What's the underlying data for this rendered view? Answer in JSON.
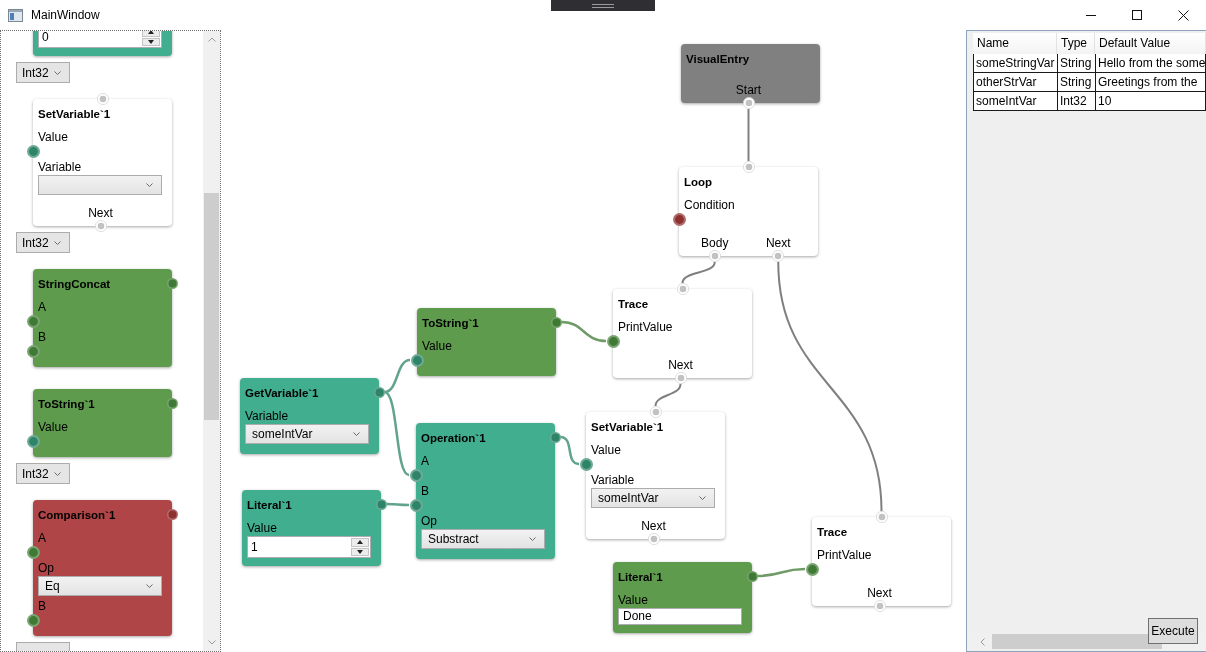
{
  "window": {
    "title": "MainWindow"
  },
  "palette": {
    "items": [
      {
        "kind": "node_fragment",
        "color": "#41af8f",
        "fields": [
          {
            "kind": "number",
            "value": "0"
          }
        ]
      },
      {
        "kind": "type_selector",
        "value": "Int32"
      },
      {
        "kind": "node",
        "title": "SetVariable`1",
        "color": "#ffffff",
        "flow_in": true,
        "fields": [
          {
            "kind": "port",
            "label": "Value",
            "color": "#2e8468"
          },
          {
            "kind": "dropdown",
            "label": "Variable"
          }
        ],
        "flow_out": [
          {
            "label": "Next"
          }
        ]
      },
      {
        "kind": "type_selector",
        "value": "Int32"
      },
      {
        "kind": "node",
        "title": "StringConcat",
        "color": "#5e9b4d",
        "flow_in": false,
        "output": {
          "color": "#3f7a34"
        },
        "fields": [
          {
            "kind": "port",
            "label": "A",
            "color": "#3f7a34"
          },
          {
            "kind": "port",
            "label": "B",
            "color": "#3f7a34"
          }
        ]
      },
      {
        "kind": "node",
        "title": "ToString`1",
        "color": "#5e9b4d",
        "flow_in": false,
        "output": {
          "color": "#3f7a34"
        },
        "fields": [
          {
            "kind": "port",
            "label": "Value",
            "color": "#2e8468"
          }
        ]
      },
      {
        "kind": "type_selector",
        "value": "Int32"
      },
      {
        "kind": "node",
        "title": "Comparison`1",
        "color": "#af4546",
        "flow_in": false,
        "output": {
          "color": "#8e2f30"
        },
        "fields": [
          {
            "kind": "port",
            "label": "A",
            "color": "#3f7a34"
          },
          {
            "kind": "dropdown",
            "label": "Op",
            "value": "Eq"
          },
          {
            "kind": "port",
            "label": "B",
            "color": "#3f7a34"
          }
        ]
      },
      {
        "kind": "type_selector"
      }
    ]
  },
  "canvas": {
    "nodes": [
      {
        "title": "VisualEntry",
        "color": "#808080",
        "flow_in": false,
        "flow_out": [
          {
            "label": "Start"
          }
        ]
      },
      {
        "title": "Loop",
        "color": "#ffffff",
        "flow_in": true,
        "fields": [
          {
            "kind": "port",
            "label": "Condition",
            "color": "#8e2f30"
          }
        ],
        "flow_out": [
          {
            "label": "Body"
          },
          {
            "label": "Next"
          }
        ]
      },
      {
        "title": "ToString`1",
        "color": "#5e9b4d",
        "flow_in": false,
        "output": {
          "color": "#3f7a34"
        },
        "fields": [
          {
            "kind": "port",
            "label": "Value",
            "color": "#2e8468"
          }
        ]
      },
      {
        "title": "Trace",
        "color": "#ffffff",
        "flow_in": true,
        "fields": [
          {
            "kind": "port",
            "label": "PrintValue",
            "color": "#3f7a34"
          }
        ],
        "flow_out": [
          {
            "label": "Next"
          }
        ]
      },
      {
        "title": "GetVariable`1",
        "color": "#41af8f",
        "flow_in": false,
        "output": {
          "color": "#2e8468"
        },
        "fields": [
          {
            "kind": "dropdown",
            "label": "Variable",
            "value": "someIntVar"
          }
        ]
      },
      {
        "title": "Literal`1",
        "color": "#41af8f",
        "flow_in": false,
        "output": {
          "color": "#2e8468"
        },
        "fields": [
          {
            "kind": "number",
            "label": "Value",
            "value": "1"
          }
        ]
      },
      {
        "title": "Operation`1",
        "color": "#41af8f",
        "flow_in": false,
        "output": {
          "color": "#2e8468"
        },
        "fields": [
          {
            "kind": "port",
            "label": "A",
            "color": "#2e8468"
          },
          {
            "kind": "port",
            "label": "B",
            "color": "#2e8468"
          },
          {
            "kind": "dropdown",
            "label": "Op",
            "value": "Substract"
          }
        ]
      },
      {
        "title": "SetVariable`1",
        "color": "#ffffff",
        "flow_in": true,
        "fields": [
          {
            "kind": "port",
            "label": "Value",
            "color": "#2e8468"
          },
          {
            "kind": "dropdown",
            "label": "Variable",
            "value": "someIntVar"
          }
        ],
        "flow_out": [
          {
            "label": "Next"
          }
        ]
      },
      {
        "title": "Literal`1",
        "color": "#5e9b4d",
        "flow_in": false,
        "output": {
          "color": "#3f7a34"
        },
        "fields": [
          {
            "kind": "text",
            "label": "Value",
            "value": "Done"
          }
        ]
      },
      {
        "title": "Trace",
        "color": "#ffffff",
        "flow_in": true,
        "fields": [
          {
            "kind": "port",
            "label": "PrintValue",
            "color": "#3f7a34"
          }
        ],
        "flow_out": [
          {
            "label": "Next"
          }
        ]
      }
    ]
  },
  "variables": {
    "columns": [
      "Name",
      "Type",
      "Default Value"
    ],
    "rows": [
      [
        "someStringVar",
        "String",
        "Hello from the some"
      ],
      [
        "otherStrVar",
        "String",
        "Greetings from the"
      ],
      [
        "someIntVar",
        "Int32",
        "10"
      ]
    ]
  },
  "execute_button": {
    "label": "Execute"
  }
}
